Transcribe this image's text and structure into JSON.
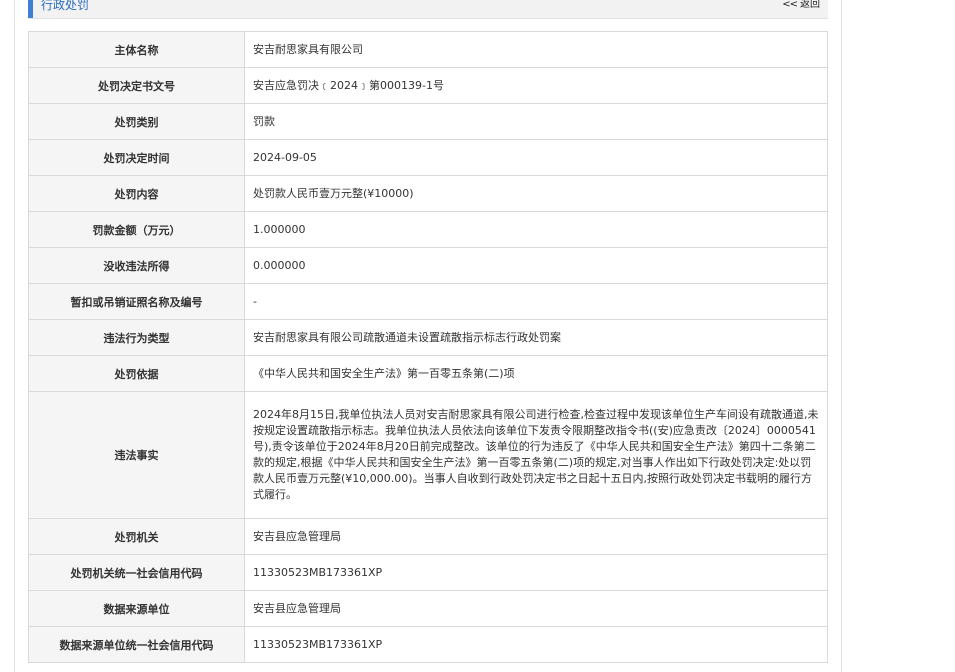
{
  "header": {
    "title": "行政处罚",
    "back_arrows": "<<",
    "back_label": "返回"
  },
  "rows": [
    {
      "label": "主体名称",
      "value": "安吉耐思家具有限公司"
    },
    {
      "label": "处罚决定书文号",
      "value": "安吉应急罚决﹝2024﹞第000139-1号"
    },
    {
      "label": "处罚类别",
      "value": "罚款"
    },
    {
      "label": "处罚决定时间",
      "value": "2024-09-05"
    },
    {
      "label": "处罚内容",
      "value": "处罚款人民币壹万元整(¥10000)"
    },
    {
      "label": "罚款金额（万元）",
      "value": "1.000000"
    },
    {
      "label": "没收违法所得",
      "value": "0.000000"
    },
    {
      "label": "暂扣或吊销证照名称及编号",
      "value": "-"
    },
    {
      "label": "违法行为类型",
      "value": "安吉耐思家具有限公司疏散通道未设置疏散指示标志行政处罚案"
    },
    {
      "label": "处罚依据",
      "value": "《中华人民共和国安全生产法》第一百零五条第(二)项"
    },
    {
      "label": "违法事实",
      "value": "2024年8月15日,我单位执法人员对安吉耐思家具有限公司进行检查,检查过程中发现该单位生产车间设有疏散通道,未按规定设置疏散指示标志。我单位执法人员依法向该单位下发责令限期整改指令书((安)应急责改〔2024〕0000541号),责令该单位于2024年8月20日前完成整改。该单位的行为违反了《中华人民共和国安全生产法》第四十二条第二款的规定,根据《中华人民共和国安全生产法》第一百零五条第(二)项的规定,对当事人作出如下行政处罚决定:处以罚款人民币壹万元整(¥10,000.00)。当事人自收到行政处罚决定书之日起十五日内,按照行政处罚决定书载明的履行方式履行。"
    },
    {
      "label": "处罚机关",
      "value": "安吉县应急管理局"
    },
    {
      "label": "处罚机关统一社会信用代码",
      "value": "11330523MB173361XP"
    },
    {
      "label": "数据来源单位",
      "value": "安吉县应急管理局"
    },
    {
      "label": "数据来源单位统一社会信用代码",
      "value": "11330523MB173361XP"
    }
  ]
}
